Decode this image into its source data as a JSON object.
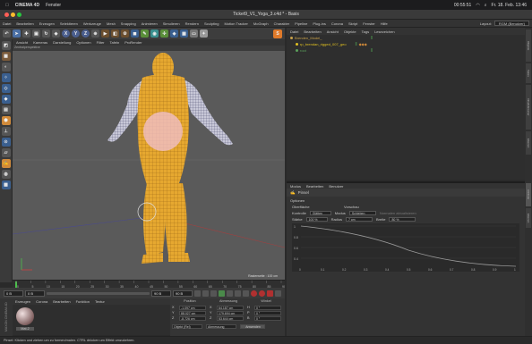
{
  "macbar": {
    "app_name": "CINEMA 4D",
    "menu": [
      "Fenster"
    ],
    "clock": "00:55:51",
    "date": "Fr. 18. Feb. 13:46"
  },
  "window": {
    "title": "Ticket9_V1_Yoga_3.c4d * - Basis"
  },
  "c4d_menu": {
    "items": [
      "Datei",
      "Bearbeiten",
      "Erzeugen",
      "Selektieren",
      "Werkzeuge",
      "Mesh",
      "Snapping",
      "Animieren",
      "Simulieren",
      "Rendern",
      "Sculpting",
      "Motion Tracker",
      "MoGraph",
      "Charakter",
      "Pipeline",
      "Plug-ins",
      "Corona",
      "Skript",
      "Fenster",
      "Hilfe"
    ],
    "layout_label": "Layout:",
    "layout_value": "RGM (Benutzer)"
  },
  "toolbar": {
    "axis_x": "X",
    "axis_y": "Y",
    "axis_z": "Z"
  },
  "viewport": {
    "menu": [
      "Ansicht",
      "Kameras",
      "Darstellung",
      "Optionen",
      "Filter",
      "Tafeln",
      "ProRender"
    ],
    "view_label": "Zentralperspektive",
    "scale_info": "Rasterweite : 100 cm"
  },
  "timeline": {
    "ticks": [
      "0",
      "5",
      "10",
      "15",
      "20",
      "25",
      "30",
      "35",
      "40",
      "45",
      "50",
      "55",
      "60",
      "65",
      "70",
      "75",
      "80",
      "85",
      "90"
    ],
    "frame_start": "0 B",
    "frame_current": "0 B",
    "frame_end": "90 B",
    "frame_end2": "90 B",
    "frame_display": "0 B"
  },
  "material_manager": {
    "menu": [
      "Erzeugen",
      "Corona",
      "Bearbeiten",
      "Funktion",
      "Textur"
    ],
    "material_name": "Mat.2",
    "brand_vertical": "MAXON CINEMA 4D"
  },
  "coordinates": {
    "headers": [
      "Position",
      "Abmessung",
      "Winkel"
    ],
    "rows": [
      {
        "axis": "X",
        "pos": "-1.097 cm",
        "size": "64.187 cm",
        "angle_label": "H",
        "angle": "0 °"
      },
      {
        "axis": "Y",
        "pos": "88.027 cm",
        "size": "179.694 cm",
        "angle_label": "P",
        "angle": "0 °"
      },
      {
        "axis": "Z",
        "pos": "-8.726 cm",
        "size": "53.644 cm",
        "angle_label": "B",
        "angle": "0 °"
      }
    ],
    "mode_select": "Objekt (Rel)",
    "size_select": "Abmessung",
    "apply_button": "Anwenden"
  },
  "object_manager": {
    "menu": [
      "Datei",
      "Bearbeiten",
      "Ansicht",
      "Objekte",
      "Tags",
      "Lesezeichen"
    ],
    "objects": [
      {
        "name": "Brenden_Model_",
        "color": "#c9a24a",
        "indent": 0
      },
      {
        "name": "rp_brendan_rigged_007_geo",
        "color": "#e0c020",
        "indent": 1
      },
      {
        "name": "root",
        "color": "#5aa05a",
        "indent": 1
      }
    ]
  },
  "attribute_manager": {
    "menu": [
      "Modus",
      "Bearbeiten",
      "Benutzer"
    ],
    "tool_title": "Pinsel",
    "section": "Optionen",
    "left_col_label": "Oberfläche",
    "right_col_label": "Vorschau",
    "fields": {
      "normal_label": "Kontrolle",
      "normal_value": "Glätten",
      "mode_label": "Modus",
      "mode_value": "Schieben",
      "strength_label": "Stärke",
      "strength_value": "100 %",
      "radius_label": "Radius",
      "radius_value": "7 cm",
      "width_label": "Breite",
      "width_value": "80 %",
      "normals_label": "Normalen aktualisieren"
    },
    "curve_y_labels": [
      "1",
      "0.8",
      "0.6",
      "0.4"
    ],
    "curve_x_labels": [
      "0",
      "0.1",
      "0.2",
      "0.3",
      "0.4",
      "0.5",
      "0.6",
      "0.7",
      "0.8",
      "0.9",
      "1"
    ]
  },
  "right_tabs": [
    "Objekte",
    "Takes",
    "Inhaltsbrowser",
    "Ebenen",
    "Attribute",
    "Ebenen"
  ],
  "status_bar": {
    "text": "Pinsel: Klicken und ziehen um zu formen/malen. CTRL drücken um Effekt umzukehren."
  }
}
